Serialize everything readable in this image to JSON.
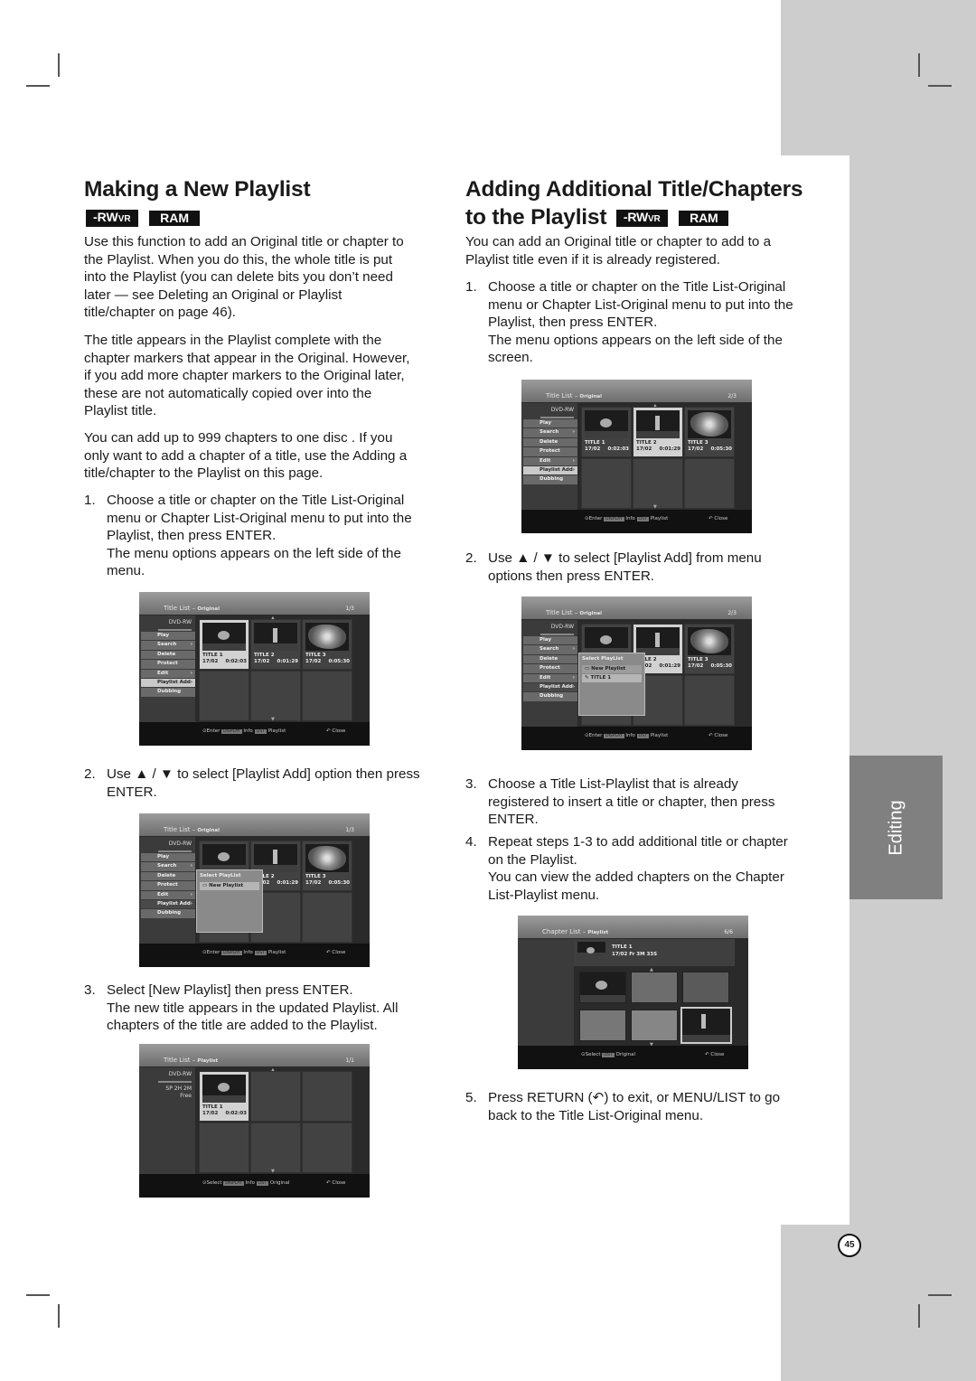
{
  "left": {
    "heading": "Making a New Playlist",
    "badges": [
      {
        "main": "-RW",
        "sub": "VR"
      },
      {
        "main": "RAM",
        "sub": ""
      }
    ],
    "paragraphs": [
      [
        "Use this function to add an Original title or chapter to",
        "the Playlist. When you do this, the whole title is put",
        "into the Playlist (you can delete bits you don’t need",
        "later — see Deleting an Original or Playlist",
        "title/chapter on page 46)."
      ],
      [
        "The title appears in the Playlist complete with the",
        "chapter markers that appear in the Original. However,",
        "if you add more chapter markers to the Original later,",
        "these are not automatically copied over into the",
        "Playlist title."
      ],
      [
        "You can add up to 999 chapters to one disc . If you",
        "only want to add a chapter of a title, use the Adding a",
        "title/chapter to the Playlist on this page."
      ]
    ],
    "steps": [
      {
        "num": "1.",
        "lines": [
          "Choose a title or chapter on the Title List-Original",
          "menu or Chapter List-Original menu to put into the",
          "Playlist, then press ENTER.",
          "The menu options appears on the left side of the",
          "menu."
        ]
      },
      {
        "num": "2.",
        "lines": [
          "Use ▲ / ▼ to select [Playlist Add] option then press",
          "ENTER."
        ]
      },
      {
        "num": "3.",
        "lines": [
          "Select [New Playlist] then press ENTER.",
          "The new title appears in the updated Playlist. All",
          "chapters of the title are added to the Playlist."
        ]
      }
    ]
  },
  "right": {
    "heading_line1": "Adding Additional Title/Chapters",
    "heading_line2": "to the Playlist",
    "badges": [
      {
        "main": "-RW",
        "sub": "VR"
      },
      {
        "main": "RAM",
        "sub": ""
      }
    ],
    "paragraph": [
      "You can add an Original title or chapter to add to a",
      "Playlist title even if it is already registered."
    ],
    "steps": [
      {
        "num": "1.",
        "lines": [
          "Choose a title or chapter on the Title List-Original",
          "menu or Chapter List-Original menu to put into the",
          "Playlist, then press ENTER.",
          "The menu options appears on the left side of the",
          "screen."
        ]
      },
      {
        "num": "2.",
        "lines": [
          "Use ▲ / ▼ to select [Playlist Add] from menu",
          "options then press ENTER."
        ]
      },
      {
        "num": "3.",
        "lines": [
          "Choose a Title List-Playlist that is already",
          "registered to insert a title or chapter, then press",
          "ENTER."
        ]
      },
      {
        "num": "4.",
        "lines": [
          "Repeat steps 1-3 to add additional title or chapter",
          "on the Playlist.",
          "You can view the added chapters on the Chapter",
          "List-Playlist menu."
        ]
      },
      {
        "num": "5.",
        "lines": [
          "Press RETURN (↶) to exit, or MENU/LIST to go",
          "back to the Title List-Original menu."
        ]
      }
    ]
  },
  "osd": {
    "disc": "DVD-RW",
    "mode": "SP",
    "remaining": "2H 2M",
    "free": "Free",
    "menu_items": [
      "Play",
      "Search",
      "Delete",
      "Protect",
      "Edit",
      "Playlist Add",
      "Dubbing"
    ],
    "titles": [
      {
        "name": "TITLE 1",
        "date": "17/02",
        "length": "0:02:03"
      },
      {
        "name": "TITLE 2",
        "date": "17/02",
        "length": "0:01:29"
      },
      {
        "name": "TITLE 3",
        "date": "17/02",
        "length": "0:05:30"
      }
    ],
    "popup_header": "Select PlayList",
    "popup_new": "New Playlist",
    "popup_title1": "TITLE 1",
    "foot_enter": "Enter",
    "foot_select": "Select",
    "foot_info": "Info",
    "foot_playlist": "Playlist",
    "foot_original": "Original",
    "foot_close": "Close",
    "key_display": "DISPLAY",
    "key_list": "LIST",
    "screens": [
      {
        "title": "Title List",
        "sub": "Original",
        "page": "1/3"
      },
      {
        "title": "Title List",
        "sub": "Original",
        "page": "1/3"
      },
      {
        "title": "Title List",
        "sub": "Playlist",
        "page": "1/1"
      },
      {
        "title": "Title List",
        "sub": "Original",
        "page": "2/3"
      },
      {
        "title": "Title List",
        "sub": "Original",
        "page": "2/3"
      },
      {
        "title": "Chapter List",
        "sub": "Playlist",
        "page": "6/6"
      }
    ],
    "chapter_info": {
      "title": "TITLE 1",
      "line2": "17/02  Fr   3M 33S"
    }
  },
  "tab_label": "Editing",
  "page_number": "45"
}
